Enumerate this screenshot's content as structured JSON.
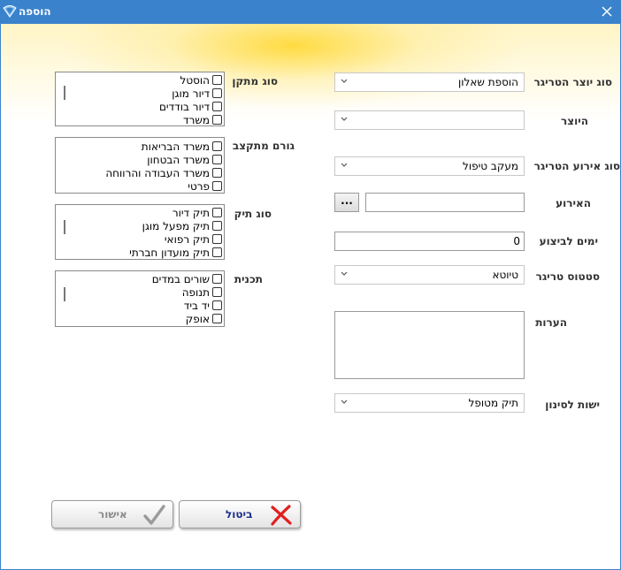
{
  "window": {
    "title": "הוספה"
  },
  "form": {
    "trigger_creator_type": {
      "label": "סוג יוצר הטריגר",
      "value": "הוספת שאלון"
    },
    "creator": {
      "label": "היוצר",
      "value": ""
    },
    "trigger_event_type": {
      "label": "סוג אירוע הטריגר",
      "value": "מעקב טיפול"
    },
    "event": {
      "label": "האירוע",
      "value": "",
      "browse_label": "..."
    },
    "days_to_execute": {
      "label": "ימים לביצוע",
      "value": "0"
    },
    "trigger_status": {
      "label": "סטטוס טריגר",
      "value": "טיוטא"
    },
    "notes": {
      "label": "הערות",
      "value": ""
    },
    "filter_entity": {
      "label": "ישות לסינון",
      "value": "תיק מטופל"
    }
  },
  "lists": {
    "facility_type": {
      "label": "סוג מתקן",
      "items": [
        "הוסטל",
        "דיור מוגן",
        "דיור בודדים",
        "משרד"
      ]
    },
    "funding_body": {
      "label": "גורם מתקצב",
      "items": [
        "משרד הבריאות",
        "משרד הבטחון",
        "משרד העבודה והרווחה",
        "פרטי"
      ]
    },
    "case_type": {
      "label": "סוג תיק",
      "items": [
        "תיק דיור",
        "תיק מפעל מוגן",
        "תיק רפואי",
        "תיק מועדון חברתי"
      ]
    },
    "program": {
      "label": "תכנית",
      "items": [
        "שורים במדים",
        "תנופה",
        "יד ביד",
        "אופק"
      ]
    }
  },
  "buttons": {
    "cancel": "ביטול",
    "confirm": "אישור"
  },
  "colors": {
    "titlebar": "#3a83cc",
    "cancel_icon": "#e02020",
    "confirm_icon": "#9a9a9a"
  }
}
